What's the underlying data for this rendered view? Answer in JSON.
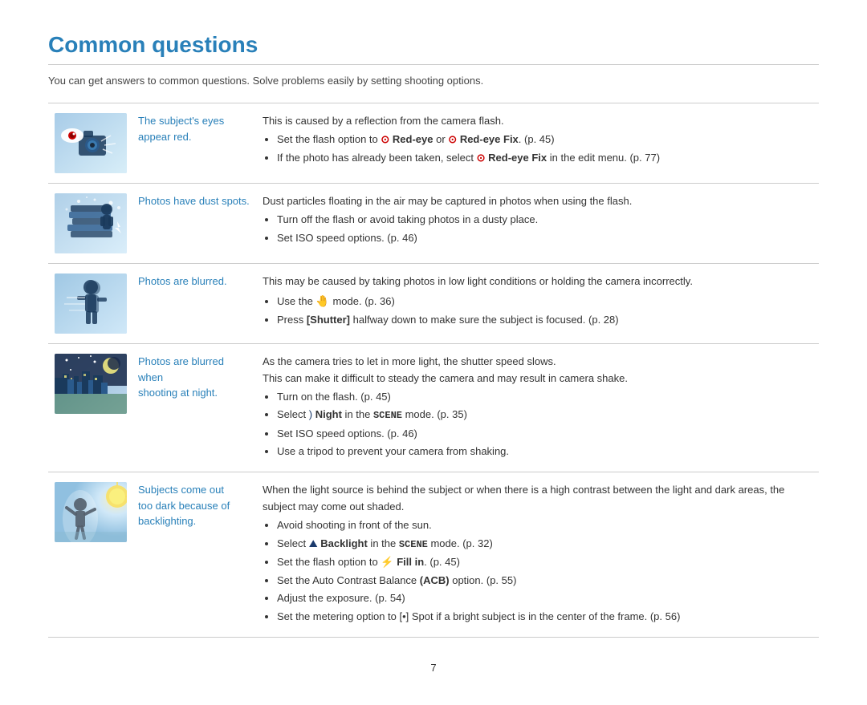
{
  "title": "Common questions",
  "subtitle": "You can get answers to common questions. Solve problems easily by setting shooting options.",
  "rows": [
    {
      "id": "red-eye",
      "label_line1": "The subject's eyes",
      "label_line2": "appear red.",
      "content_intro": "This is caused by a reflection from the camera flash.",
      "bullets": [
        "Set the flash option to 🔴 Red-eye or 🔴 Red-eye Fix. (p. 45)",
        "If the photo has already been taken, select 🔴 Red-eye Fix in the edit menu. (p. 77)"
      ]
    },
    {
      "id": "dust-spots",
      "label_line1": "Photos have dust spots.",
      "label_line2": "",
      "content_intro": "Dust particles floating in the air may be captured in photos when using the flash.",
      "bullets": [
        "Turn off the flash or avoid taking photos in a dusty place.",
        "Set ISO speed options. (p. 46)"
      ]
    },
    {
      "id": "blurred",
      "label_line1": "Photos are blurred.",
      "label_line2": "",
      "content_intro": "This may be caused by taking photos in low light conditions or holding the camera incorrectly.",
      "bullets": [
        "Use the 🤚 mode. (p. 36)",
        "Press [Shutter] halfway down to make sure the subject is focused. (p. 28)"
      ]
    },
    {
      "id": "night",
      "label_line1": "Photos are blurred when",
      "label_line2": "shooting at night.",
      "content_intro": "As the camera tries to let in more light, the shutter speed slows.",
      "content_intro2": "This can make it difficult to steady the camera and may result in camera shake.",
      "bullets": [
        "Turn on the flash. (p. 45)",
        "Select 🌙 Night in the SCENE mode. (p. 35)",
        "Set ISO speed options. (p. 46)",
        "Use a tripod to prevent your camera from shaking."
      ]
    },
    {
      "id": "backlight",
      "label_line1": "Subjects come out",
      "label_line2": "too dark because of",
      "label_line3": "backlighting.",
      "content_intro": "When the light source is behind the subject or when there is a high contrast between the light and dark areas, the subject may come out shaded.",
      "bullets": [
        "Avoid shooting in front of the sun.",
        "Select 🌄 Backlight in the SCENE mode. (p. 32)",
        "Set the flash option to ⚡ Fill in. (p. 45)",
        "Set the Auto Contrast Balance (ACB) option. (p. 55)",
        "Adjust the exposure. (p. 54)",
        "Set the metering option to [•] Spot if a bright subject is in the center of the frame. (p. 56)"
      ]
    }
  ],
  "page_number": "7"
}
